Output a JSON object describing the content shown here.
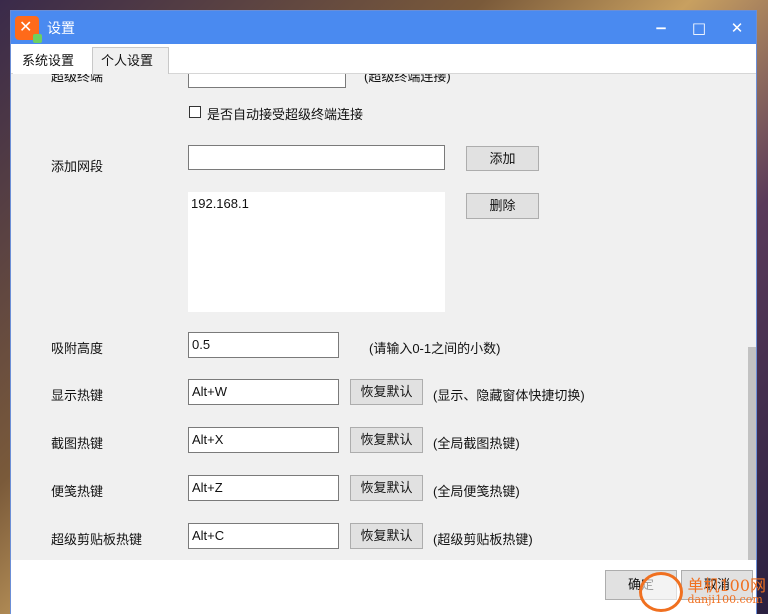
{
  "window": {
    "title": "设置"
  },
  "tabs": [
    {
      "label": "系统设置",
      "active": true
    },
    {
      "label": "个人设置",
      "active": false
    }
  ],
  "cut_row": {
    "label": "超级终端",
    "hint": "(超级终端连接)"
  },
  "auto_accept": {
    "label": "是否自动接受超级终端连接",
    "checked": false
  },
  "segment": {
    "label": "添加网段",
    "input_value": "",
    "add_button": "添加",
    "delete_button": "删除",
    "list": [
      "192.168.1"
    ]
  },
  "snap_height": {
    "label": "吸附高度",
    "value": "0.5",
    "hint": "(请输入0-1之间的小数)"
  },
  "hotkeys": [
    {
      "label": "显示热键",
      "value": "Alt+W",
      "reset": "恢复默认",
      "hint": "(显示、隐藏窗体快捷切换)"
    },
    {
      "label": "截图热键",
      "value": "Alt+X",
      "reset": "恢复默认",
      "hint": "(全局截图热键)"
    },
    {
      "label": "便笺热键",
      "value": "Alt+Z",
      "reset": "恢复默认",
      "hint": "(全局便笺热键)"
    },
    {
      "label": "超级剪贴板热键",
      "value": "Alt+C",
      "reset": "恢复默认",
      "hint": "(超级剪贴板热键)"
    }
  ],
  "footer": {
    "ok": "确定",
    "cancel": "取消"
  },
  "watermark": {
    "line1": "单机100网",
    "line2": "danji100.com"
  }
}
